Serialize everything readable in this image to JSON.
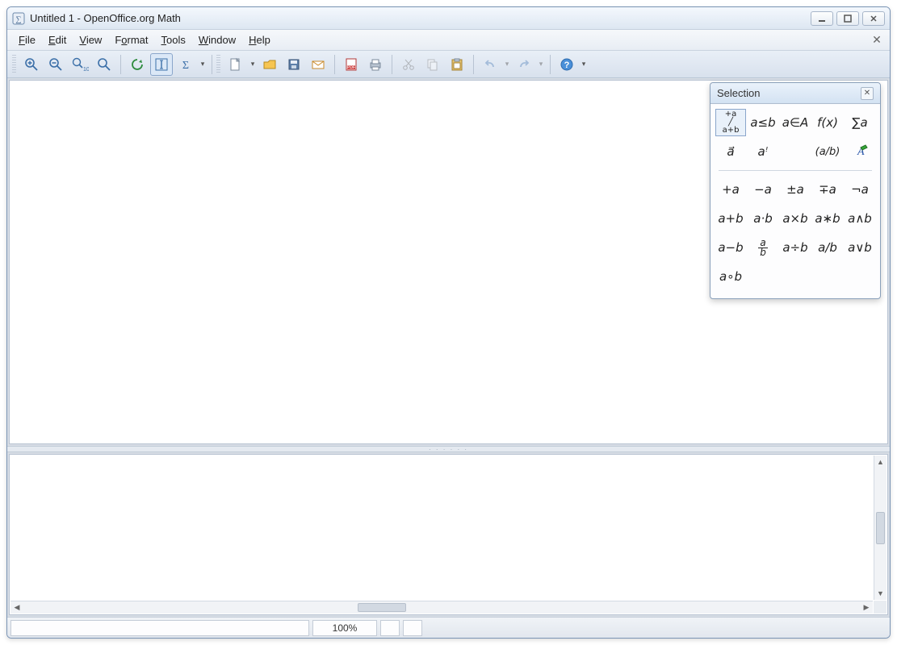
{
  "window": {
    "title": "Untitled 1 - OpenOffice.org Math"
  },
  "menu": {
    "file": "File",
    "edit": "Edit",
    "view": "View",
    "format": "Format",
    "tools": "Tools",
    "window": "Window",
    "help": "Help"
  },
  "toolbar": {
    "zoom_in": "Zoom In",
    "zoom_out": "Zoom Out",
    "zoom_100": "Zoom 100%",
    "zoom_fit": "Show All",
    "refresh": "Update",
    "cursor": "Formula Cursor",
    "sigma": "Formula Elements",
    "new": "New",
    "open": "Open",
    "save": "Save",
    "mail": "Document as E-mail",
    "pdf": "Export as PDF",
    "print": "Print",
    "cut": "Cut",
    "copy": "Copy",
    "paste": "Paste",
    "undo": "Undo",
    "redo": "Redo",
    "help": "Help"
  },
  "status": {
    "zoom": "100%"
  },
  "selection": {
    "title": "Selection",
    "categories": {
      "unary_binary": "+a / a+b",
      "relations": "a≤b",
      "set": "a∈A",
      "functions": "f(x)",
      "operators": "∑a",
      "attributes": "a⃗",
      "others": "aꜝ",
      "brackets": "(a/b)",
      "formats": "A✎"
    },
    "ops": {
      "plus_a": "+a",
      "minus_a": "−a",
      "pm_a": "±a",
      "mp_a": "∓a",
      "neg_a": "¬a",
      "a_plus_b": "a+b",
      "a_cdot_b": "a·b",
      "a_times_b": "a×b",
      "a_ast_b": "a∗b",
      "a_and_b": "a∧b",
      "a_minus_b": "a−b",
      "a_over_b": "a⁄b",
      "a_div_b": "a÷b",
      "a_slash_b": "a/b",
      "a_or_b": "a∨b",
      "a_circ_b": "a∘b"
    }
  }
}
